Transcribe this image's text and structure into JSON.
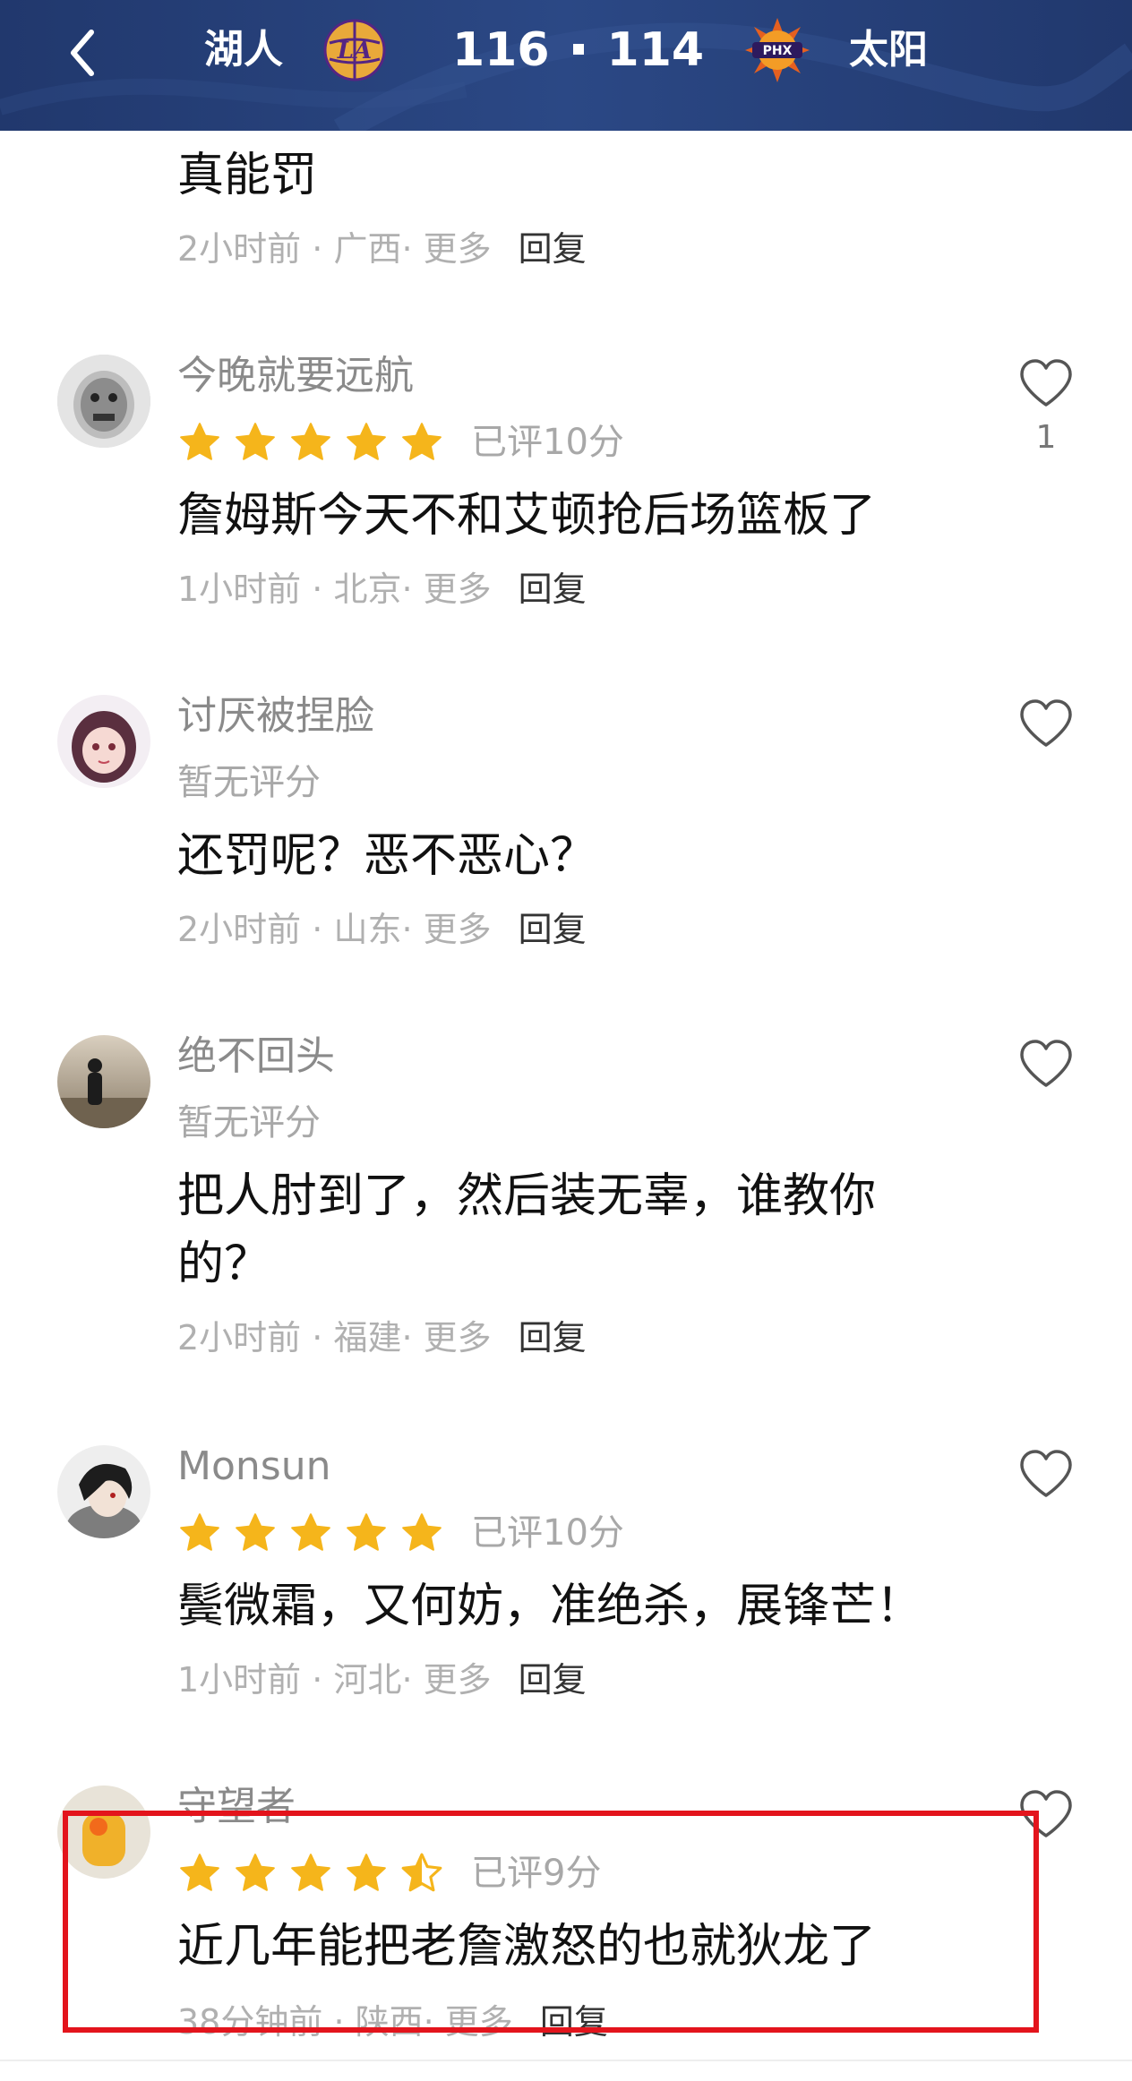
{
  "header": {
    "home_team": "湖人",
    "away_team": "太阳",
    "home_score": "116",
    "away_score": "114",
    "home_logo_text": "LA",
    "away_logo_text": "PHX",
    "background_color": "#233b70"
  },
  "comments": [
    {
      "username": "",
      "rating_text": "",
      "body": "真能罚",
      "time": "2小时前",
      "location": "广西",
      "more": "更多",
      "reply": "回复",
      "likes": ""
    },
    {
      "username": "今晚就要远航",
      "stars": 5,
      "rating_text": "已评10分",
      "body": "詹姆斯今天不和艾顿抢后场篮板了",
      "time": "1小时前",
      "location": "北京",
      "more": "更多",
      "reply": "回复",
      "likes": "1"
    },
    {
      "username": "讨厌被捏脸",
      "rating_text": "暂无评分",
      "body": "还罚呢？恶不恶心？",
      "time": "2小时前",
      "location": "山东",
      "more": "更多",
      "reply": "回复",
      "likes": ""
    },
    {
      "username": "绝不回头",
      "rating_text": "暂无评分",
      "body": "把人肘到了，然后装无辜，谁教你的？",
      "time": "2小时前",
      "location": "福建",
      "more": "更多",
      "reply": "回复",
      "likes": ""
    },
    {
      "username": "Monsun",
      "stars": 5,
      "rating_text": "已评10分",
      "body": "鬓微霜，又何妨，准绝杀，展锋芒！",
      "time": "1小时前",
      "location": "河北",
      "more": "更多",
      "reply": "回复",
      "likes": ""
    },
    {
      "username": "守望者",
      "stars": 4.5,
      "rating_text": "已评9分",
      "body": "近几年能把老詹激怒的也就狄龙了",
      "time": "38分钟前",
      "location": "陕西",
      "more": "更多",
      "reply": "回复",
      "likes": ""
    }
  ],
  "colors": {
    "star": "#f5b51b",
    "highlight": "#e3141c"
  }
}
